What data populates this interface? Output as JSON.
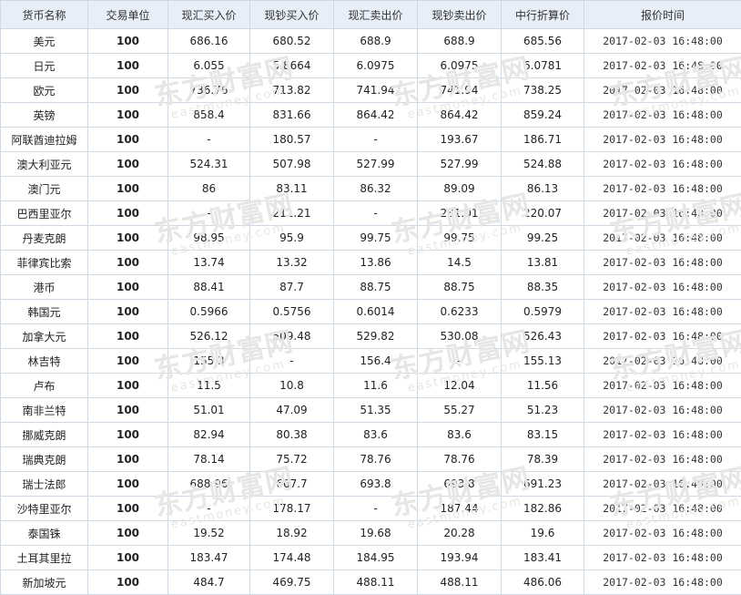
{
  "table": {
    "headers": [
      "货币名称",
      "交易单位",
      "现汇买入价",
      "现钞买入价",
      "现汇卖出价",
      "现钞卖出价",
      "中行折算价",
      "报价时间"
    ],
    "rows": [
      [
        "美元",
        "100",
        "686.16",
        "680.52",
        "688.9",
        "688.9",
        "685.56",
        "2017-02-03 16:48:00"
      ],
      [
        "日元",
        "100",
        "6.055",
        "5.8664",
        "6.0975",
        "6.0975",
        "6.0781",
        "2017-02-03 16:48:00"
      ],
      [
        "欧元",
        "100",
        "736.76",
        "713.82",
        "741.94",
        "741.94",
        "738.25",
        "2017-02-03 16:48:00"
      ],
      [
        "英镑",
        "100",
        "858.4",
        "831.66",
        "864.42",
        "864.42",
        "859.24",
        "2017-02-03 16:48:00"
      ],
      [
        "阿联酋迪拉姆",
        "100",
        "-",
        "180.57",
        "-",
        "193.67",
        "186.71",
        "2017-02-03 16:48:00"
      ],
      [
        "澳大利亚元",
        "100",
        "524.31",
        "507.98",
        "527.99",
        "527.99",
        "524.88",
        "2017-02-03 16:48:00"
      ],
      [
        "澳门元",
        "100",
        "86",
        "83.11",
        "86.32",
        "89.09",
        "86.13",
        "2017-02-03 16:48:00"
      ],
      [
        "巴西里亚尔",
        "100",
        "-",
        "211.21",
        "-",
        "231.01",
        "220.07",
        "2017-02-03 16:48:00"
      ],
      [
        "丹麦克朗",
        "100",
        "98.95",
        "95.9",
        "99.75",
        "99.75",
        "99.25",
        "2017-02-03 16:48:00"
      ],
      [
        "菲律宾比索",
        "100",
        "13.74",
        "13.32",
        "13.86",
        "14.5",
        "13.81",
        "2017-02-03 16:48:00"
      ],
      [
        "港币",
        "100",
        "88.41",
        "87.7",
        "88.75",
        "88.75",
        "88.35",
        "2017-02-03 16:48:00"
      ],
      [
        "韩国元",
        "100",
        "0.5966",
        "0.5756",
        "0.6014",
        "0.6233",
        "0.5979",
        "2017-02-03 16:48:00"
      ],
      [
        "加拿大元",
        "100",
        "526.12",
        "509.48",
        "529.82",
        "530.08",
        "526.43",
        "2017-02-03 16:48:00"
      ],
      [
        "林吉特",
        "100",
        "155.3",
        "-",
        "156.4",
        "-",
        "155.13",
        "2017-02-03 16:48:00"
      ],
      [
        "卢布",
        "100",
        "11.5",
        "10.8",
        "11.6",
        "12.04",
        "11.56",
        "2017-02-03 16:48:00"
      ],
      [
        "南非兰特",
        "100",
        "51.01",
        "47.09",
        "51.35",
        "55.27",
        "51.23",
        "2017-02-03 16:48:00"
      ],
      [
        "挪威克朗",
        "100",
        "82.94",
        "80.38",
        "83.6",
        "83.6",
        "83.15",
        "2017-02-03 16:48:00"
      ],
      [
        "瑞典克朗",
        "100",
        "78.14",
        "75.72",
        "78.76",
        "78.76",
        "78.39",
        "2017-02-03 16:48:00"
      ],
      [
        "瑞士法郎",
        "100",
        "688.96",
        "667.7",
        "693.8",
        "693.8",
        "691.23",
        "2017-02-03 16:48:00"
      ],
      [
        "沙特里亚尔",
        "100",
        "-",
        "178.17",
        "-",
        "187.44",
        "182.86",
        "2017-02-03 16:48:00"
      ],
      [
        "泰国铢",
        "100",
        "19.52",
        "18.92",
        "19.68",
        "20.28",
        "19.6",
        "2017-02-03 16:48:00"
      ],
      [
        "土耳其里拉",
        "100",
        "183.47",
        "174.48",
        "184.95",
        "193.94",
        "183.41",
        "2017-02-03 16:48:00"
      ],
      [
        "新加坡元",
        "100",
        "484.7",
        "469.75",
        "488.11",
        "488.11",
        "486.06",
        "2017-02-03 16:48:00"
      ]
    ]
  },
  "watermark": {
    "brand_cn": "东方财富网",
    "brand_en": "eastmoney.com",
    "color": "#e6e6e6"
  },
  "colors": {
    "header_bg": "#e7eef8",
    "border": "#cfd9e4",
    "text": "#222222"
  }
}
